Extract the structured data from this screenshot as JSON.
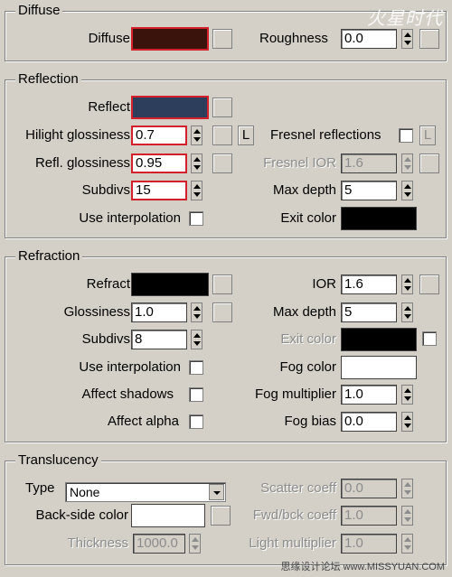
{
  "watermark_top": "火星时代",
  "watermark_bottom": "思缘设计论坛 www.MISSYUAN.COM",
  "colors": {
    "diffuse": "#3a130c",
    "reflect": "#2c3e5c",
    "refract": "#000000",
    "exit_color_reflection": "#000000",
    "exit_color_refraction": "#000000",
    "fog_color": "#ffffff",
    "backside_color": "#ffffff",
    "highlight_border": "#d4202a"
  },
  "diffuse": {
    "title": "Diffuse",
    "diffuse_label": "Diffuse",
    "roughness_label": "Roughness",
    "roughness_value": "0.0"
  },
  "reflection": {
    "title": "Reflection",
    "reflect_label": "Reflect",
    "hilight_glossiness_label": "Hilight glossiness",
    "hilight_glossiness_value": "0.7",
    "l_button": "L",
    "fresnel_reflections_label": "Fresnel reflections",
    "fresnel_l_button": "L",
    "refl_glossiness_label": "Refl. glossiness",
    "refl_glossiness_value": "0.95",
    "fresnel_ior_label": "Fresnel IOR",
    "fresnel_ior_value": "1.6",
    "subdivs_label": "Subdivs",
    "subdivs_value": "15",
    "max_depth_label": "Max depth",
    "max_depth_value": "5",
    "use_interpolation_label": "Use interpolation",
    "exit_color_label": "Exit color"
  },
  "refraction": {
    "title": "Refraction",
    "refract_label": "Refract",
    "ior_label": "IOR",
    "ior_value": "1.6",
    "glossiness_label": "Glossiness",
    "glossiness_value": "1.0",
    "max_depth_label": "Max depth",
    "max_depth_value": "5",
    "subdivs_label": "Subdivs",
    "subdivs_value": "8",
    "exit_color_label": "Exit color",
    "use_interpolation_label": "Use interpolation",
    "fog_color_label": "Fog color",
    "affect_shadows_label": "Affect shadows",
    "fog_multiplier_label": "Fog multiplier",
    "fog_multiplier_value": "1.0",
    "affect_alpha_label": "Affect alpha",
    "fog_bias_label": "Fog bias",
    "fog_bias_value": "0.0"
  },
  "translucency": {
    "title": "Translucency",
    "type_label": "Type",
    "type_value": "None",
    "scatter_coeff_label": "Scatter coeff",
    "scatter_coeff_value": "0.0",
    "backside_color_label": "Back-side color",
    "fwd_bck_coeff_label": "Fwd/bck coeff",
    "fwd_bck_coeff_value": "1.0",
    "thickness_label": "Thickness",
    "thickness_value": "1000.0",
    "light_multiplier_label": "Light multiplier",
    "light_multiplier_value": "1.0"
  }
}
